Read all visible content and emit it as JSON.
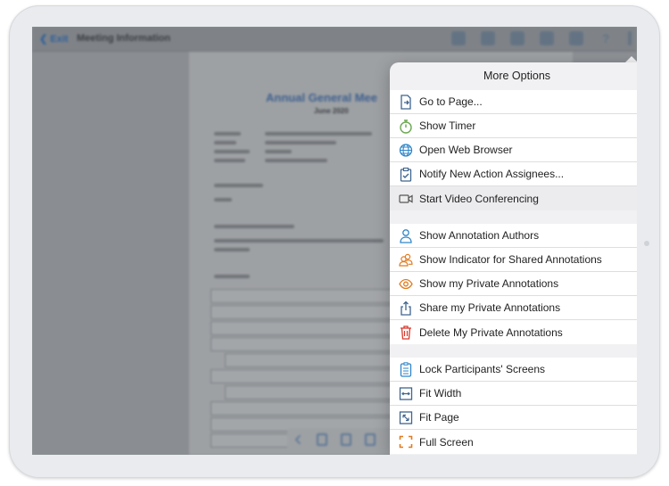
{
  "navbar": {
    "back_label": "❮ Exit",
    "title": "Meeting Information"
  },
  "document": {
    "title": "Annual General Mee",
    "subtitle": "June 2020"
  },
  "popover": {
    "title": "More Options",
    "groups": [
      {
        "items": [
          {
            "label": "Go to Page...",
            "icon": "page-arrow-icon",
            "color": "#3f648f"
          },
          {
            "label": "Show Timer",
            "icon": "stopwatch-icon",
            "color": "#6aa84f"
          },
          {
            "label": "Open Web Browser",
            "icon": "globe-icon",
            "color": "#2f86c9"
          },
          {
            "label": "Notify New Action Assignees...",
            "icon": "clipboard-check-icon",
            "color": "#3f648f"
          },
          {
            "label": "Start Video Conferencing",
            "icon": "video-camera-icon",
            "color": "#555555",
            "highlighted": true
          }
        ]
      },
      {
        "items": [
          {
            "label": "Show Annotation Authors",
            "icon": "person-icon",
            "color": "#2f86c9"
          },
          {
            "label": "Show Indicator for Shared Annotations",
            "icon": "people-icon",
            "color": "#e07b1f"
          },
          {
            "label": "Show my Private Annotations",
            "icon": "eye-icon",
            "color": "#e07b1f"
          },
          {
            "label": "Share my Private Annotations",
            "icon": "share-icon",
            "color": "#3f648f"
          },
          {
            "label": "Delete My Private Annotations",
            "icon": "trash-icon",
            "color": "#d9382d"
          }
        ]
      },
      {
        "items": [
          {
            "label": "Lock Participants' Screens",
            "icon": "lock-screen-icon",
            "color": "#2f86c9"
          },
          {
            "label": "Fit Width",
            "icon": "fit-width-icon",
            "color": "#3f648f"
          },
          {
            "label": "Fit Page",
            "icon": "fit-page-icon",
            "color": "#3f648f"
          },
          {
            "label": "Full Screen",
            "icon": "full-screen-icon",
            "color": "#e07b1f"
          }
        ]
      }
    ]
  }
}
